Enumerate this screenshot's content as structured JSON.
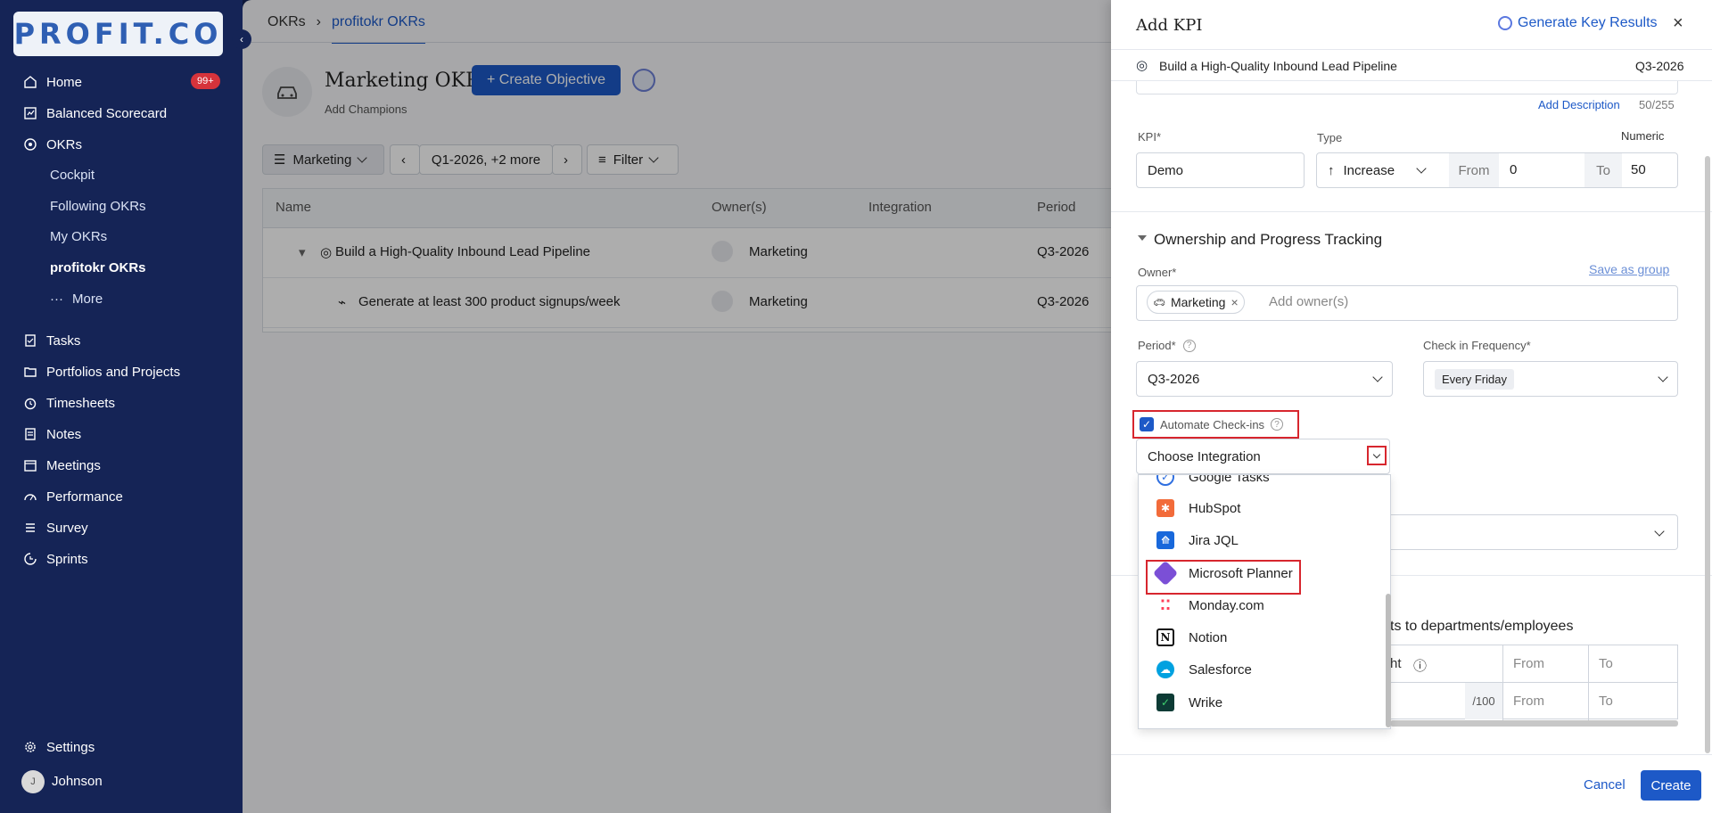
{
  "sidebar": {
    "logo": "PROFIT.CO",
    "badge": "99+",
    "items": [
      {
        "label": "Home",
        "icon": "home-icon"
      },
      {
        "label": "Balanced Scorecard",
        "icon": "scorecard-icon"
      },
      {
        "label": "OKRs",
        "icon": "target-icon"
      },
      {
        "label": "Tasks",
        "icon": "tasks-icon"
      },
      {
        "label": "Portfolios and Projects",
        "icon": "folder-icon"
      },
      {
        "label": "Timesheets",
        "icon": "clock-icon"
      },
      {
        "label": "Notes",
        "icon": "notes-icon"
      },
      {
        "label": "Meetings",
        "icon": "calendar-icon"
      },
      {
        "label": "Performance",
        "icon": "performance-icon"
      },
      {
        "label": "Survey",
        "icon": "survey-icon"
      },
      {
        "label": "Sprints",
        "icon": "sprint-icon"
      }
    ],
    "okr_sub": [
      "Cockpit",
      "Following OKRs",
      "My OKRs",
      "profitokr OKRs",
      "More"
    ],
    "settings": "Settings",
    "user": "Johnson",
    "user_initial": "J"
  },
  "main": {
    "breadcrumb": [
      "OKRs",
      "profitokr OKRs"
    ],
    "title": "Marketing OKRs",
    "add_champions": "Add Champions",
    "create_objective": "+ Create Objective",
    "toolbar": {
      "team": "Marketing",
      "period": "Q1-2026, +2 more",
      "filter": "Filter"
    },
    "columns": [
      "Name",
      "Owner(s)",
      "Integration",
      "Period"
    ],
    "rows": [
      {
        "name": "Build a High-Quality Inbound Lead Pipeline",
        "owner": "Marketing",
        "period": "Q3-2026"
      },
      {
        "name": "Generate at least 300 product signups/week",
        "owner": "Marketing",
        "period": "Q3-2026"
      }
    ]
  },
  "drawer": {
    "title": "Add KPI",
    "generate": "Generate Key Results",
    "objective": "Build a High-Quality Inbound Lead Pipeline",
    "objective_period": "Q3-2026",
    "add_description": "Add Description",
    "char_count": "50/255",
    "kpi_label": "KPI*",
    "kpi_value": "Demo",
    "type_label": "Type",
    "numeric": "Numeric",
    "type_value": "Increase",
    "from_label": "From",
    "from_value": "0",
    "to_label": "To",
    "to_value": "50",
    "section": "Ownership and Progress Tracking",
    "owner_label": "Owner*",
    "save_group": "Save as group",
    "owner_chip": "Marketing",
    "owner_placeholder": "Add owner(s)",
    "period_label": "Period*",
    "period_value": "Q3-2026",
    "freq_label": "Check in Frequency*",
    "freq_value": "Every Friday",
    "automate": "Automate Check-ins",
    "choose": "Choose Integration",
    "align_text": "ts to departments/employees",
    "grid": {
      "h1": "ht",
      "from": "From",
      "to": "To",
      "weight": "/100"
    },
    "cancel": "Cancel",
    "create": "Create"
  },
  "dropdown": {
    "items": [
      {
        "label": "Google Tasks",
        "color": "#2f6fe0",
        "icon": "google-tasks-icon"
      },
      {
        "label": "HubSpot",
        "color": "#f26b3a",
        "icon": "hubspot-icon"
      },
      {
        "label": "Jira JQL",
        "color": "#1868db",
        "icon": "jira-icon"
      },
      {
        "label": "Microsoft Planner",
        "color": "#7b4fd6",
        "icon": "planner-icon"
      },
      {
        "label": "Monday.com",
        "color": "#ffcb00",
        "icon": "monday-icon"
      },
      {
        "label": "Notion",
        "color": "#111111",
        "icon": "notion-icon"
      },
      {
        "label": "Salesforce",
        "color": "#00a1e0",
        "icon": "salesforce-icon"
      },
      {
        "label": "Wrike",
        "color": "#0d3b35",
        "icon": "wrike-icon"
      }
    ]
  }
}
